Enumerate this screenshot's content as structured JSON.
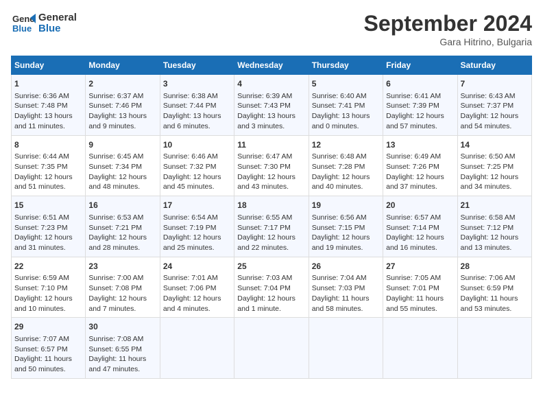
{
  "header": {
    "logo_line1": "General",
    "logo_line2": "Blue",
    "month": "September 2024",
    "location": "Gara Hitrino, Bulgaria"
  },
  "days_of_week": [
    "Sunday",
    "Monday",
    "Tuesday",
    "Wednesday",
    "Thursday",
    "Friday",
    "Saturday"
  ],
  "weeks": [
    [
      {
        "day": "1",
        "lines": [
          "Sunrise: 6:36 AM",
          "Sunset: 7:48 PM",
          "Daylight: 13 hours",
          "and 11 minutes."
        ]
      },
      {
        "day": "2",
        "lines": [
          "Sunrise: 6:37 AM",
          "Sunset: 7:46 PM",
          "Daylight: 13 hours",
          "and 9 minutes."
        ]
      },
      {
        "day": "3",
        "lines": [
          "Sunrise: 6:38 AM",
          "Sunset: 7:44 PM",
          "Daylight: 13 hours",
          "and 6 minutes."
        ]
      },
      {
        "day": "4",
        "lines": [
          "Sunrise: 6:39 AM",
          "Sunset: 7:43 PM",
          "Daylight: 13 hours",
          "and 3 minutes."
        ]
      },
      {
        "day": "5",
        "lines": [
          "Sunrise: 6:40 AM",
          "Sunset: 7:41 PM",
          "Daylight: 13 hours",
          "and 0 minutes."
        ]
      },
      {
        "day": "6",
        "lines": [
          "Sunrise: 6:41 AM",
          "Sunset: 7:39 PM",
          "Daylight: 12 hours",
          "and 57 minutes."
        ]
      },
      {
        "day": "7",
        "lines": [
          "Sunrise: 6:43 AM",
          "Sunset: 7:37 PM",
          "Daylight: 12 hours",
          "and 54 minutes."
        ]
      }
    ],
    [
      {
        "day": "8",
        "lines": [
          "Sunrise: 6:44 AM",
          "Sunset: 7:35 PM",
          "Daylight: 12 hours",
          "and 51 minutes."
        ]
      },
      {
        "day": "9",
        "lines": [
          "Sunrise: 6:45 AM",
          "Sunset: 7:34 PM",
          "Daylight: 12 hours",
          "and 48 minutes."
        ]
      },
      {
        "day": "10",
        "lines": [
          "Sunrise: 6:46 AM",
          "Sunset: 7:32 PM",
          "Daylight: 12 hours",
          "and 45 minutes."
        ]
      },
      {
        "day": "11",
        "lines": [
          "Sunrise: 6:47 AM",
          "Sunset: 7:30 PM",
          "Daylight: 12 hours",
          "and 43 minutes."
        ]
      },
      {
        "day": "12",
        "lines": [
          "Sunrise: 6:48 AM",
          "Sunset: 7:28 PM",
          "Daylight: 12 hours",
          "and 40 minutes."
        ]
      },
      {
        "day": "13",
        "lines": [
          "Sunrise: 6:49 AM",
          "Sunset: 7:26 PM",
          "Daylight: 12 hours",
          "and 37 minutes."
        ]
      },
      {
        "day": "14",
        "lines": [
          "Sunrise: 6:50 AM",
          "Sunset: 7:25 PM",
          "Daylight: 12 hours",
          "and 34 minutes."
        ]
      }
    ],
    [
      {
        "day": "15",
        "lines": [
          "Sunrise: 6:51 AM",
          "Sunset: 7:23 PM",
          "Daylight: 12 hours",
          "and 31 minutes."
        ]
      },
      {
        "day": "16",
        "lines": [
          "Sunrise: 6:53 AM",
          "Sunset: 7:21 PM",
          "Daylight: 12 hours",
          "and 28 minutes."
        ]
      },
      {
        "day": "17",
        "lines": [
          "Sunrise: 6:54 AM",
          "Sunset: 7:19 PM",
          "Daylight: 12 hours",
          "and 25 minutes."
        ]
      },
      {
        "day": "18",
        "lines": [
          "Sunrise: 6:55 AM",
          "Sunset: 7:17 PM",
          "Daylight: 12 hours",
          "and 22 minutes."
        ]
      },
      {
        "day": "19",
        "lines": [
          "Sunrise: 6:56 AM",
          "Sunset: 7:15 PM",
          "Daylight: 12 hours",
          "and 19 minutes."
        ]
      },
      {
        "day": "20",
        "lines": [
          "Sunrise: 6:57 AM",
          "Sunset: 7:14 PM",
          "Daylight: 12 hours",
          "and 16 minutes."
        ]
      },
      {
        "day": "21",
        "lines": [
          "Sunrise: 6:58 AM",
          "Sunset: 7:12 PM",
          "Daylight: 12 hours",
          "and 13 minutes."
        ]
      }
    ],
    [
      {
        "day": "22",
        "lines": [
          "Sunrise: 6:59 AM",
          "Sunset: 7:10 PM",
          "Daylight: 12 hours",
          "and 10 minutes."
        ]
      },
      {
        "day": "23",
        "lines": [
          "Sunrise: 7:00 AM",
          "Sunset: 7:08 PM",
          "Daylight: 12 hours",
          "and 7 minutes."
        ]
      },
      {
        "day": "24",
        "lines": [
          "Sunrise: 7:01 AM",
          "Sunset: 7:06 PM",
          "Daylight: 12 hours",
          "and 4 minutes."
        ]
      },
      {
        "day": "25",
        "lines": [
          "Sunrise: 7:03 AM",
          "Sunset: 7:04 PM",
          "Daylight: 12 hours",
          "and 1 minute."
        ]
      },
      {
        "day": "26",
        "lines": [
          "Sunrise: 7:04 AM",
          "Sunset: 7:03 PM",
          "Daylight: 11 hours",
          "and 58 minutes."
        ]
      },
      {
        "day": "27",
        "lines": [
          "Sunrise: 7:05 AM",
          "Sunset: 7:01 PM",
          "Daylight: 11 hours",
          "and 55 minutes."
        ]
      },
      {
        "day": "28",
        "lines": [
          "Sunrise: 7:06 AM",
          "Sunset: 6:59 PM",
          "Daylight: 11 hours",
          "and 53 minutes."
        ]
      }
    ],
    [
      {
        "day": "29",
        "lines": [
          "Sunrise: 7:07 AM",
          "Sunset: 6:57 PM",
          "Daylight: 11 hours",
          "and 50 minutes."
        ]
      },
      {
        "day": "30",
        "lines": [
          "Sunrise: 7:08 AM",
          "Sunset: 6:55 PM",
          "Daylight: 11 hours",
          "and 47 minutes."
        ]
      },
      {
        "day": "",
        "lines": []
      },
      {
        "day": "",
        "lines": []
      },
      {
        "day": "",
        "lines": []
      },
      {
        "day": "",
        "lines": []
      },
      {
        "day": "",
        "lines": []
      }
    ]
  ]
}
